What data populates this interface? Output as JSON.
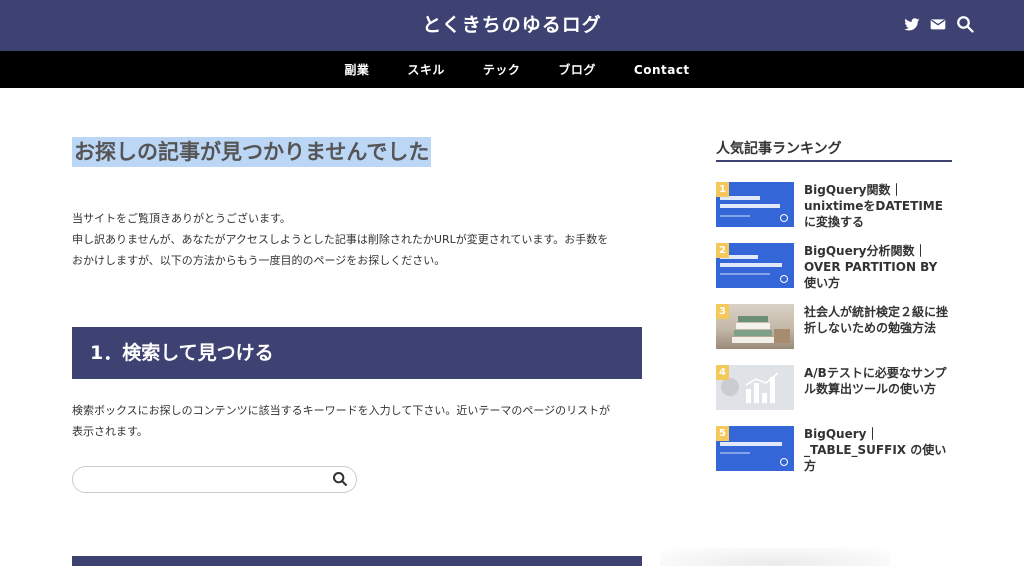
{
  "header": {
    "site_title": "とくきちのゆるログ",
    "icons": [
      "twitter-icon",
      "mail-icon",
      "search-icon"
    ],
    "bg_color": "#3e4272"
  },
  "nav": {
    "items": [
      {
        "label": "副業"
      },
      {
        "label": "スキル"
      },
      {
        "label": "テック"
      },
      {
        "label": "ブログ"
      },
      {
        "label": "Contact"
      }
    ]
  },
  "main": {
    "page_title": "お探しの記事が見つかりませんでした",
    "intro_line1": "当サイトをご覧頂きありがとうございます。",
    "intro_line2": "申し訳ありませんが、あなたがアクセスしようとした記事は削除されたかURLが変更されています。お手数を",
    "intro_line3": "おかけしますが、以下の方法からもう一度目的のページをお探しください。",
    "section1_heading": "1．検索して見つける",
    "section1_desc_line1": "検索ボックスにお探しのコンテンツに該当するキーワードを入力して下さい。近いテーマのページのリストが",
    "section1_desc_line2": "表示されます。",
    "search": {
      "value": "",
      "placeholder": ""
    }
  },
  "sidebar": {
    "ranking_title": "人気記事ランキング",
    "items": [
      {
        "rank": "1",
        "title": "BigQuery関数｜unixtimeをDATETIMEに変換する",
        "thumb_text": "BigQuery関数 unixtimeをDATETIMEに変換する"
      },
      {
        "rank": "2",
        "title": "BigQuery分析関数｜OVER PARTITION BY 使い方",
        "thumb_text": "BigQuery分析関数 OVER PARTITION BY 使い方"
      },
      {
        "rank": "3",
        "title": "社会人が統計検定２級に挫折しないための勉強方法",
        "thumb_text": ""
      },
      {
        "rank": "4",
        "title": "A/Bテストに必要なサンプル数算出ツールの使い方",
        "thumb_text": ""
      },
      {
        "rank": "5",
        "title": "BigQuery｜_TABLE_SUFFIX の使い方",
        "thumb_text": "Query _TABLE_SUFFIX の使い方"
      }
    ],
    "rank_badge_color": "#f5c85b"
  }
}
